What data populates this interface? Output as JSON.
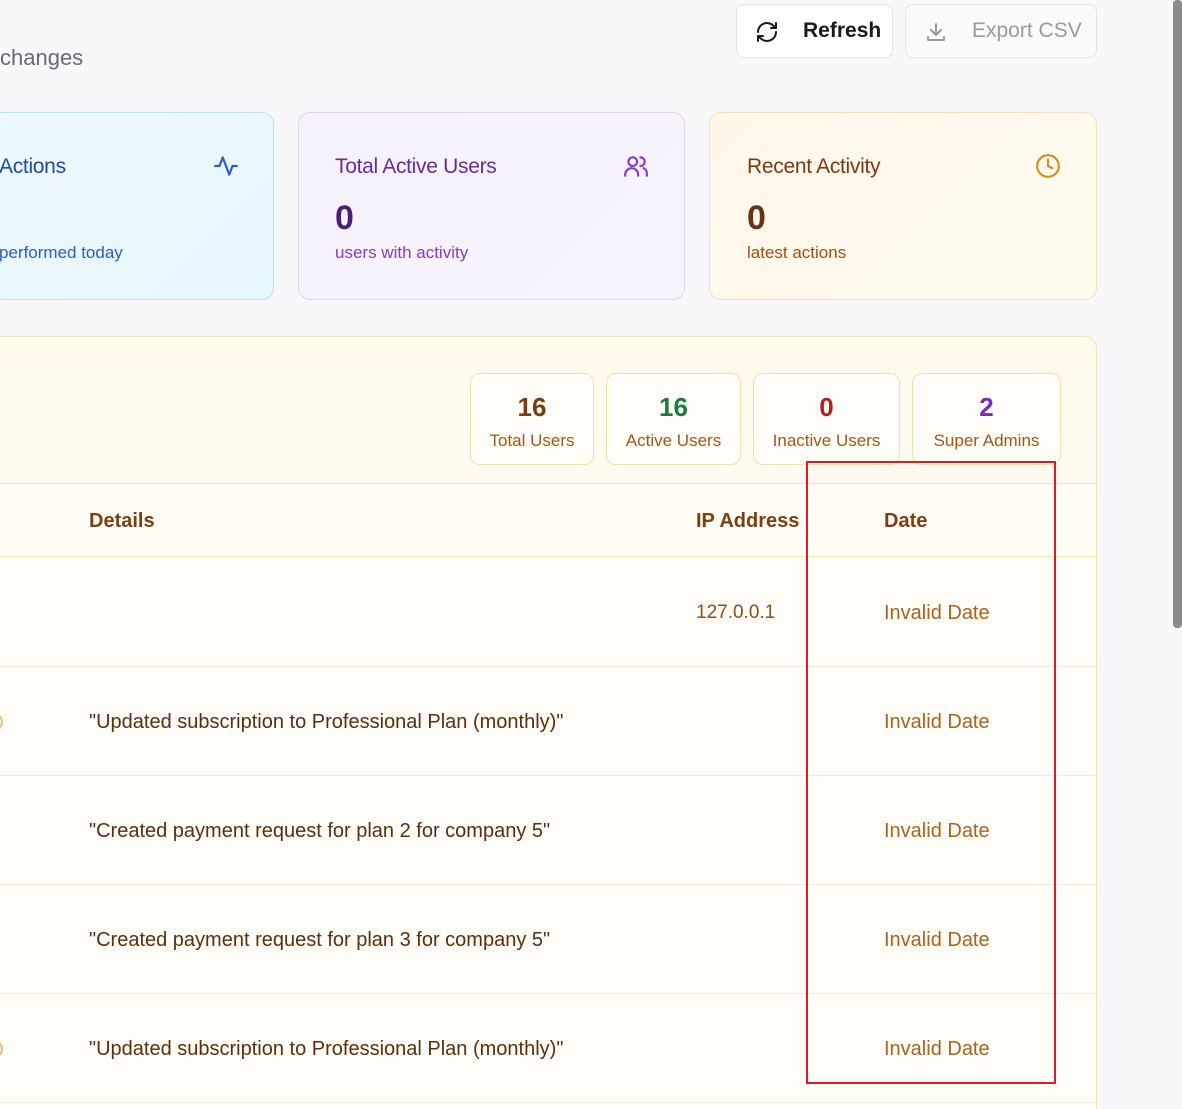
{
  "header": {
    "subtitle_fragment": "changes",
    "refresh_label": "Refresh",
    "export_label": "Export CSV"
  },
  "cards": [
    {
      "title": "Actions",
      "value": "",
      "sub": "performed today",
      "icon": "activity-icon"
    },
    {
      "title": "Total Active Users",
      "value": "0",
      "sub": "users with activity",
      "icon": "users-icon"
    },
    {
      "title": "Recent Activity",
      "value": "0",
      "sub": "latest actions",
      "icon": "clock-icon"
    }
  ],
  "stats": [
    {
      "value": "16",
      "label": "Total Users"
    },
    {
      "value": "16",
      "label": "Active Users"
    },
    {
      "value": "0",
      "label": "Inactive Users"
    },
    {
      "value": "2",
      "label": "Super Admins"
    }
  ],
  "table": {
    "columns": {
      "details": "Details",
      "ip": "IP Address",
      "date": "Date"
    },
    "rows": [
      {
        "details": "",
        "ip": "127.0.0.1",
        "date": "Invalid Date"
      },
      {
        "details": "\"Updated subscription to Professional Plan (monthly)\"",
        "ip": "",
        "date": "Invalid Date"
      },
      {
        "details": "\"Created payment request for plan 2 for company 5\"",
        "ip": "",
        "date": "Invalid Date"
      },
      {
        "details": "\"Created payment request for plan 3 for company 5\"",
        "ip": "",
        "date": "Invalid Date"
      },
      {
        "details": "\"Updated subscription to Professional Plan (monthly)\"",
        "ip": "",
        "date": "Invalid Date"
      }
    ]
  },
  "colors": {
    "highlight": "#e01b24",
    "accent_amber": "#f4e3b8"
  }
}
